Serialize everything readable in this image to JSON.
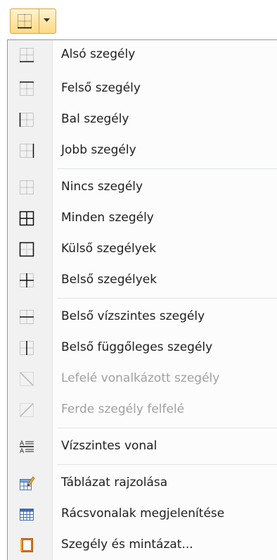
{
  "items": [
    {
      "label": "Alsó szegély"
    },
    {
      "label": "Felső szegély"
    },
    {
      "label": "Bal szegély"
    },
    {
      "label": "Jobb szegély"
    },
    {
      "label": "Nincs szegély"
    },
    {
      "label": "Minden szegély"
    },
    {
      "label": "Külső szegélyek"
    },
    {
      "label": "Belső szegélyek"
    },
    {
      "label": "Belső vízszintes szegély"
    },
    {
      "label": "Belső függőleges szegély"
    },
    {
      "label": "Lefelé vonalkázott szegély"
    },
    {
      "label": "Ferde szegély felfelé"
    },
    {
      "label": "Vízszintes vonal"
    },
    {
      "label": "Táblázat rajzolása"
    },
    {
      "label": "Rácsvonalak megjelenítése"
    },
    {
      "label": "Szegély és mintázat..."
    }
  ],
  "colors": {
    "accent": "#ffd982",
    "border": "#d9a54a",
    "disabled": "#a0a0a0"
  }
}
